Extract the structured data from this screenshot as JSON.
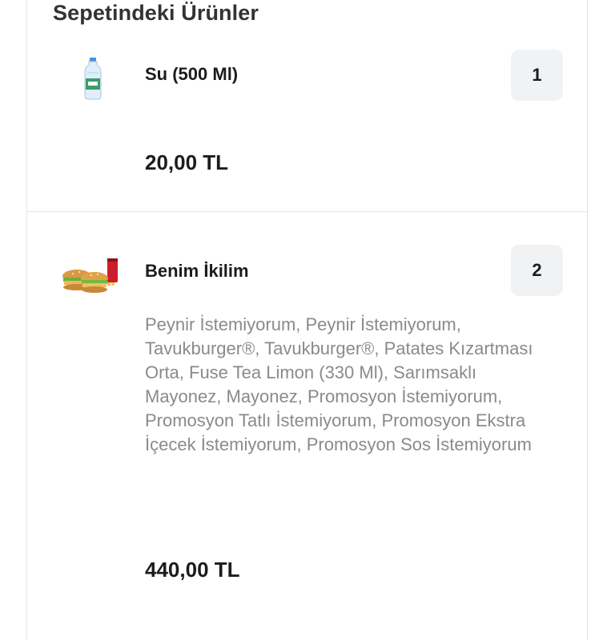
{
  "cart": {
    "title": "Sepetindeki Ürünler",
    "items": [
      {
        "name": "Su (500 Ml)",
        "quantity": "1",
        "description": "",
        "price": "20,00 TL",
        "icon": "water-bottle-icon"
      },
      {
        "name": "Benim İkilim",
        "quantity": "2",
        "description": "Peynir İstemiyorum, Peynir İstemiyorum, Tavukburger®, Tavukburger®, Patates Kızartması Orta, Fuse Tea Limon (330 Ml), Sarımsaklı Mayonez, Mayonez, Promosyon İstemiyorum, Promosyon Tatlı İstemiyorum, Promosyon Ekstra İçecek İstemiyorum, Promosyon Sos İstemiyorum",
        "price": "440,00 TL",
        "icon": "burger-menu-icon"
      }
    ]
  }
}
